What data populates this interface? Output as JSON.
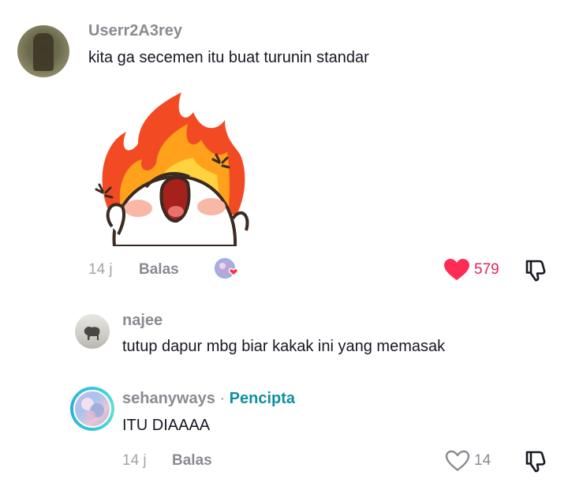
{
  "main_comment": {
    "username": "Userr2A3rey",
    "text": "kita ga secemen itu buat turunin standar",
    "time": "14 j",
    "reply_label": "Balas",
    "likes": "579",
    "liked": true,
    "sticker_icon": "angry-fire-sticker",
    "liked_by_creator_icon": "creator-liked-avatar-icon"
  },
  "replies": [
    {
      "username": "najee",
      "text": "tutup dapur mbg biar kakak ini yang memasak"
    },
    {
      "username": "sehanyways",
      "separator": "·",
      "badge": "Pencipta",
      "text": "ITU DIAAAA",
      "time": "14 j",
      "reply_label": "Balas",
      "likes": "14",
      "liked": false
    }
  ],
  "colors": {
    "like_red": "#fe2c55",
    "creator_teal": "#0f8fa0",
    "muted": "#8a8b91"
  }
}
